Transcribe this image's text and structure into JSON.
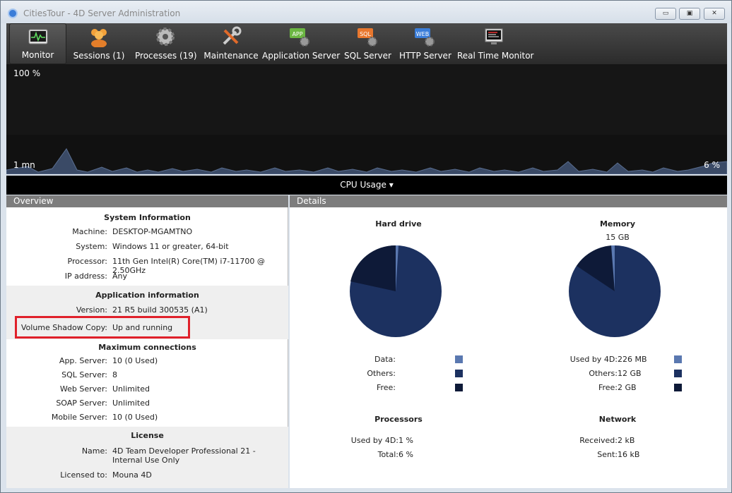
{
  "window": {
    "title": "CitiesTour - 4D Server Administration",
    "minimize": "▭",
    "maximize": "▣",
    "close": "✕"
  },
  "toolbar": {
    "items": [
      {
        "label": "Monitor"
      },
      {
        "label": "Sessions (1)"
      },
      {
        "label": "Processes (19)"
      },
      {
        "label": "Maintenance"
      },
      {
        "label": "Application Server"
      },
      {
        "label": "SQL Server"
      },
      {
        "label": "HTTP Server"
      },
      {
        "label": "Real Time Monitor"
      }
    ],
    "badges": {
      "app": "APP",
      "sql": "SQL",
      "web": "WEB"
    }
  },
  "graph": {
    "top_label": "100 %",
    "time_label": "1 mn",
    "current_label": "6 %",
    "selector": "CPU Usage"
  },
  "overview": {
    "header": "Overview",
    "system": {
      "title": "System Information",
      "machine_k": "Machine:",
      "machine_v": "DESKTOP-MGAMTNO",
      "system_k": "System:",
      "system_v": "Windows 11 or greater, 64-bit",
      "processor_k": "Processor:",
      "processor_v": "11th Gen Intel(R) Core(TM) i7-11700 @ 2.50GHz",
      "ip_k": "IP address:",
      "ip_v": "Any"
    },
    "application": {
      "title": "Application information",
      "version_k": "Version:",
      "version_v": "21 R5 build 300535 (A1)",
      "vsc_k": "Volume Shadow Copy:",
      "vsc_v": "Up and running"
    },
    "connections": {
      "title": "Maximum connections",
      "app_k": "App. Server:",
      "app_v": "10 (0 Used)",
      "sql_k": "SQL Server:",
      "sql_v": "8",
      "web_k": "Web Server:",
      "web_v": "Unlimited",
      "soap_k": "SOAP Server:",
      "soap_v": "Unlimited",
      "mobile_k": "Mobile Server:",
      "mobile_v": "10 (0 Used)"
    },
    "license": {
      "title": "License",
      "name_k": "Name:",
      "name_v": "4D Team Developer Professional 21 - Internal Use Only",
      "licensed_k": "Licensed to:",
      "licensed_v": "Mouna 4D"
    }
  },
  "details": {
    "header": "Details",
    "hard_drive": {
      "title": "Hard drive",
      "data_k": "Data:",
      "others_k": "Others:",
      "free_k": "Free:"
    },
    "memory": {
      "title": "Memory",
      "total": "15 GB",
      "used_k": "Used by 4D:",
      "used_v": "226 MB",
      "others_k": "Others:",
      "others_v": "12 GB",
      "free_k": "Free:",
      "free_v": "2 GB"
    },
    "processors": {
      "title": "Processors",
      "used_k": "Used by 4D:",
      "used_v": "1 %",
      "total_k": "Total:",
      "total_v": "6 %"
    },
    "network": {
      "title": "Network",
      "received_k": "Received:",
      "received_v": "2 kB",
      "sent_k": "Sent:",
      "sent_v": "16 kB"
    },
    "colors": {
      "data": "#5a78b0",
      "others": "#1c3160",
      "free": "#0e1a38"
    }
  }
}
